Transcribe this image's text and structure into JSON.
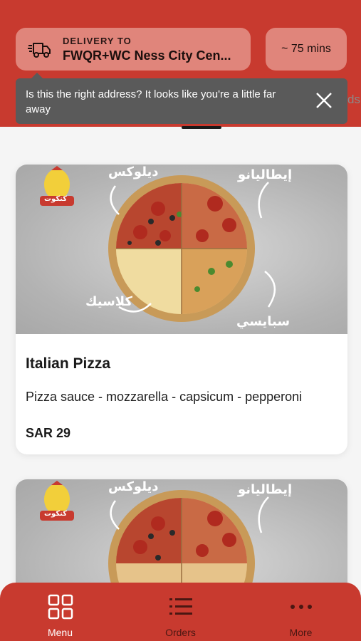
{
  "header": {
    "delivery_label": "DELIVERY TO",
    "delivery_address": "FWQR+WC Ness City Cen...",
    "delivery_time": "~ 75 mins",
    "tooltip_text": "Is this the right address? It looks like you're a little far away",
    "peek_text": "ds"
  },
  "menu_items": [
    {
      "title": "Italian Pizza",
      "description": "Pizza sauce - mozzarella - capsicum - pepperoni",
      "price": "SAR 29",
      "image_words": {
        "top_left": "ديلوكس",
        "top_right": "إيطاليانو",
        "bottom_left": "كلاسيك",
        "bottom_right": "سبايسي",
        "logo": "كنكوت"
      }
    },
    {
      "image_words": {
        "top_left": "ديلوكس",
        "top_right": "إيطاليانو",
        "logo": "كنكوت"
      }
    }
  ],
  "bottom_nav": {
    "items": [
      {
        "label": "Menu",
        "icon": "grid-icon",
        "active": true
      },
      {
        "label": "Orders",
        "icon": "list-icon",
        "active": false
      },
      {
        "label": "More",
        "icon": "more-dots-icon",
        "active": false
      }
    ]
  },
  "colors": {
    "brand_red": "#c83a2f",
    "pill_bg": "#e0857b",
    "tooltip_bg": "#5a5a5a"
  }
}
